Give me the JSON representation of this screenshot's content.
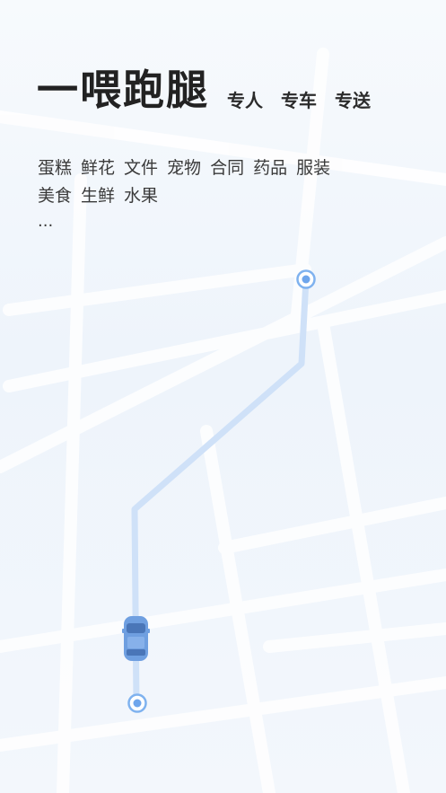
{
  "header": {
    "title": "一喂跑腿",
    "tags": [
      "专人",
      "专车",
      "专送"
    ]
  },
  "categories": {
    "row1": [
      "蛋糕",
      "鲜花",
      "文件",
      "宠物",
      "合同",
      "药品",
      "服装"
    ],
    "row2": [
      "美食",
      "生鲜",
      "水果"
    ],
    "more": "..."
  },
  "colors": {
    "route": "#cfe1f8",
    "marker": "#7fb2ef",
    "car_body": "#6f9fe0",
    "title": "#222222"
  },
  "icons": {
    "start": "location-pin-icon",
    "end": "destination-pin-icon",
    "vehicle": "car-icon"
  }
}
